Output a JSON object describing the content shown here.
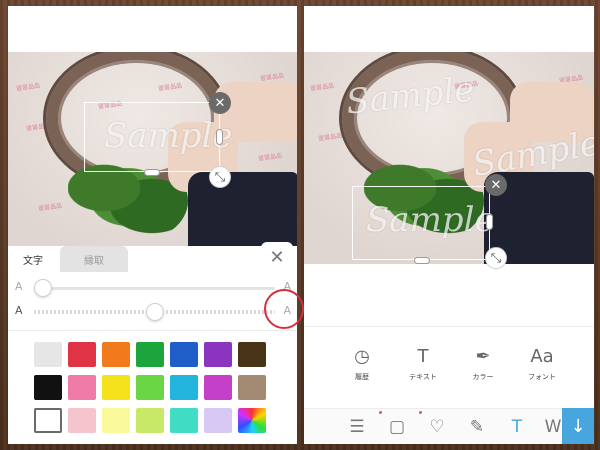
{
  "left_screen": {
    "sample_text": "Sample",
    "tabs": [
      {
        "label": "文字",
        "active": true
      },
      {
        "label": "縁取",
        "active": false
      }
    ],
    "close_label": "✕",
    "slider_a_label": "A",
    "size_slider_value": 0.0,
    "opacity_slider_value": 0.5,
    "palette_colors": [
      [
        "#e6e6e6",
        "#e03446",
        "#f07a1c",
        "#1ea43c",
        "#1f5ec8",
        "#8a34c0",
        "#4a3418"
      ],
      [
        "#111111",
        "#f07aa8",
        "#f5e11c",
        "#6ad646",
        "#22b4dc",
        "#c440c8",
        "#a38a72"
      ],
      [
        "#ffffff",
        "#f6c4cc",
        "#fafa9a",
        "#c8e868",
        "#40dcc4",
        "#d8c8f4",
        "gradient"
      ]
    ],
    "selected_swatch": "#ffffff"
  },
  "right_screen": {
    "sample_text": "Sample",
    "tools": [
      {
        "icon": "clock-icon",
        "glyph": "◷",
        "label": "履歴"
      },
      {
        "icon": "text-icon",
        "glyph": "T",
        "label": "テキスト"
      },
      {
        "icon": "eyedropper-icon",
        "glyph": "✒",
        "label": "カラー"
      },
      {
        "icon": "font-icon",
        "glyph": "Aa",
        "label": "フォント"
      }
    ],
    "toolbar_icons": [
      {
        "name": "adjust-icon",
        "glyph": "☰"
      },
      {
        "name": "frame-icon",
        "glyph": "▢"
      },
      {
        "name": "heart-icon",
        "glyph": "♡"
      },
      {
        "name": "brush-icon",
        "glyph": "✎"
      },
      {
        "name": "text-tool-icon",
        "glyph": "T"
      },
      {
        "name": "w-tool-icon",
        "glyph": "W"
      }
    ],
    "download_glyph": "↓",
    "accent_color": "#48a6de"
  },
  "watermark_stamp": "冒冒品品"
}
